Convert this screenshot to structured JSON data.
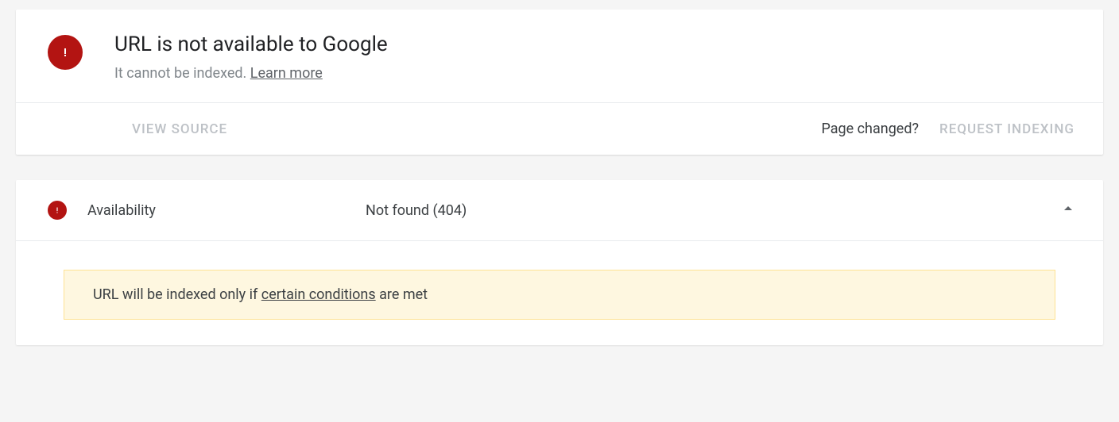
{
  "header": {
    "title": "URL is not available to Google",
    "subtitle_prefix": "It cannot be indexed. ",
    "learn_more": "Learn more"
  },
  "actions": {
    "view_source": "VIEW SOURCE",
    "page_changed": "Page changed?",
    "request_indexing": "REQUEST INDEXING"
  },
  "availability": {
    "label": "Availability",
    "status": "Not found (404)"
  },
  "notice": {
    "prefix": "URL will be indexed only if ",
    "link": "certain conditions",
    "suffix": " are met"
  }
}
